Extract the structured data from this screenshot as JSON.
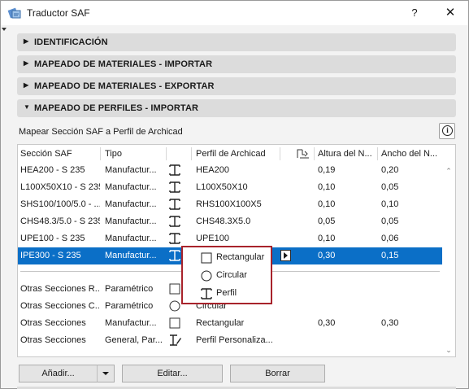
{
  "window": {
    "title": "Traductor SAF",
    "help_label": "?",
    "close_label": "✕"
  },
  "sections": [
    {
      "label": "IDENTIFICACIÓN",
      "expanded": false
    },
    {
      "label": "MAPEADO DE MATERIALES - IMPORTAR",
      "expanded": false
    },
    {
      "label": "MAPEADO DE MATERIALES - EXPORTAR",
      "expanded": false
    },
    {
      "label": "MAPEADO DE PERFILES - IMPORTAR",
      "expanded": true
    }
  ],
  "panel": {
    "subtitle": "Mapear Sección SAF a Perfil de Archicad",
    "info_label": "i"
  },
  "table": {
    "headers": {
      "seccion": "Sección SAF",
      "tipo": "Tipo",
      "perfil": "Perfil de Archicad",
      "altura": "Altura del N...",
      "ancho": "Ancho del N..."
    },
    "rows": [
      {
        "seccion": "HEA200 - S 235",
        "tipo": "Manufactur...",
        "icon": "i-beam-icon",
        "perfil": "HEA200",
        "altura": "0,19",
        "ancho": "0,20",
        "selected": false
      },
      {
        "seccion": "L100X50X10 - S 235",
        "tipo": "Manufactur...",
        "icon": "i-beam-icon",
        "perfil": "L100X50X10",
        "altura": "0,10",
        "ancho": "0,05",
        "selected": false
      },
      {
        "seccion": "SHS100/100/5.0 - ...",
        "tipo": "Manufactur...",
        "icon": "i-beam-icon",
        "perfil": "RHS100X100X5",
        "altura": "0,10",
        "ancho": "0,10",
        "selected": false
      },
      {
        "seccion": "CHS48.3/5.0 - S 235",
        "tipo": "Manufactur...",
        "icon": "i-beam-icon",
        "perfil": "CHS48.3X5.0",
        "altura": "0,05",
        "ancho": "0,05",
        "selected": false
      },
      {
        "seccion": "UPE100 - S 235",
        "tipo": "Manufactur...",
        "icon": "i-beam-icon",
        "perfil": "UPE100",
        "altura": "0,10",
        "ancho": "0,06",
        "selected": false
      },
      {
        "seccion": "IPE300 - S 235",
        "tipo": "Manufactur...",
        "icon": "i-beam-icon",
        "perfil": "",
        "altura": "0,30",
        "ancho": "0,15",
        "selected": true
      }
    ],
    "other_rows": [
      {
        "seccion": "Otras Secciones R...",
        "tipo": "Paramétrico",
        "icon": "square-icon",
        "perfil": "",
        "altura": "",
        "ancho": ""
      },
      {
        "seccion": "Otras Secciones C...",
        "tipo": "Paramétrico",
        "icon": "circle-icon",
        "perfil": "Circular",
        "altura": "",
        "ancho": ""
      },
      {
        "seccion": "Otras Secciones",
        "tipo": "Manufactur...",
        "icon": "square-icon",
        "perfil": "Rectangular",
        "altura": "0,30",
        "ancho": "0,30"
      },
      {
        "seccion": "Otras Secciones",
        "tipo": "General, Par...",
        "icon": "custom-profile-icon",
        "perfil": "Perfil Personaliza...",
        "altura": "",
        "ancho": ""
      }
    ]
  },
  "popup": {
    "items": [
      {
        "label": "Rectangular",
        "icon": "square-icon"
      },
      {
        "label": "Circular",
        "icon": "circle-icon"
      },
      {
        "label": "Perfil",
        "icon": "i-beam-icon"
      }
    ]
  },
  "buttons": {
    "add": "Añadir...",
    "edit": "Editar...",
    "delete": "Borrar"
  },
  "colors": {
    "selection": "#0b6fc7",
    "highlight_border": "#a8232b"
  }
}
